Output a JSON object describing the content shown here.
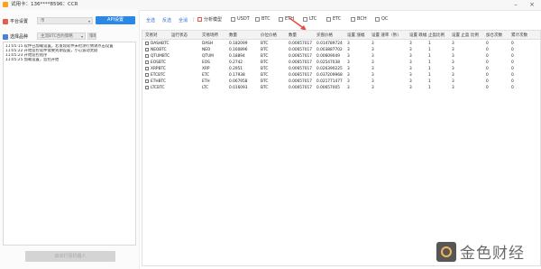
{
  "window": {
    "title": "试用卡：136****8596：CCR",
    "min_glyph": "–",
    "close_glyph": "×"
  },
  "left": {
    "platform_label": "平台设置",
    "platform_value": "币",
    "api_button": "API设置",
    "strategy_label": "选择品种",
    "strategy_value": "主流BTC合约策略",
    "strategy_button": "策略",
    "log": [
      "11:05:15  软件已加载设置，若发现软件未检测行情请点击设置",
      "11:05:22  开始监控软件需要到期设置，小心波动太剧",
      "11:05:23  开始监控程序",
      "11:05:25  加载设置，监控开始"
    ],
    "start_button": "启动行情机器人"
  },
  "toolbar": {
    "links": [
      "全选",
      "反选",
      "全消"
    ],
    "filter_label": "分析模型",
    "checkboxes": [
      "USDT",
      "BTC",
      "ETH",
      "LTC",
      "ETC",
      "BCH",
      "QC"
    ]
  },
  "table": {
    "headers": [
      "交易对",
      "运行状态",
      "交易场所",
      "数量",
      "价位价格",
      "数量",
      "买盘价格",
      "设置 涨幅",
      "设置 速率（秒）",
      "设置 跌幅",
      "止盈比例",
      "设置 止盈 比例",
      "加仓次数",
      "累计次数"
    ],
    "rows": [
      [
        "DASHBTC",
        "",
        "DASH",
        "0.182099",
        "BTC",
        "0.00657017",
        "0.014789724",
        "3",
        "3",
        "3",
        "1",
        "3",
        "0",
        "0"
      ],
      [
        "NEOBTC",
        "",
        "NEO",
        "0.160896",
        "BTC",
        "0.00657017",
        "0.003887702",
        "3",
        "3",
        "3",
        "1",
        "3",
        "0",
        "0"
      ],
      [
        "QTUMBTC",
        "",
        "QTUM",
        "0.18894",
        "BTC",
        "0.00657017",
        "0.00609049",
        "3",
        "3",
        "3",
        "1",
        "3",
        "0",
        "0"
      ],
      [
        "EOSBTC",
        "",
        "EOS",
        "0.2742",
        "BTC",
        "0.00657017",
        "0.02547038",
        "3",
        "3",
        "3",
        "1",
        "3",
        "0",
        "0"
      ],
      [
        "XRPBTC",
        "",
        "XRP",
        "0.2951",
        "BTC",
        "0.00657017",
        "0.026390225",
        "3",
        "3",
        "3",
        "1",
        "3",
        "0",
        "0"
      ],
      [
        "ETCBTC",
        "",
        "ETC",
        "0.17938",
        "BTC",
        "0.00657017",
        "0.037209968",
        "3",
        "3",
        "3",
        "1",
        "3",
        "0",
        "0"
      ],
      [
        "ETHBTC",
        "",
        "ETH",
        "0.067958",
        "BTC",
        "0.00657017",
        "0.021771477",
        "3",
        "3",
        "3",
        "1",
        "3",
        "0",
        "0"
      ],
      [
        "LTCBTC",
        "",
        "LTC",
        "0.016093",
        "BTC",
        "0.00657017",
        "0.00657005",
        "3",
        "3",
        "3",
        "1",
        "3",
        "0",
        "0"
      ]
    ]
  },
  "watermark": {
    "text": "金色财经"
  },
  "colors": {
    "accent": "#2b89e6",
    "alert": "#e85a4f",
    "brand": "#f4a11e"
  }
}
